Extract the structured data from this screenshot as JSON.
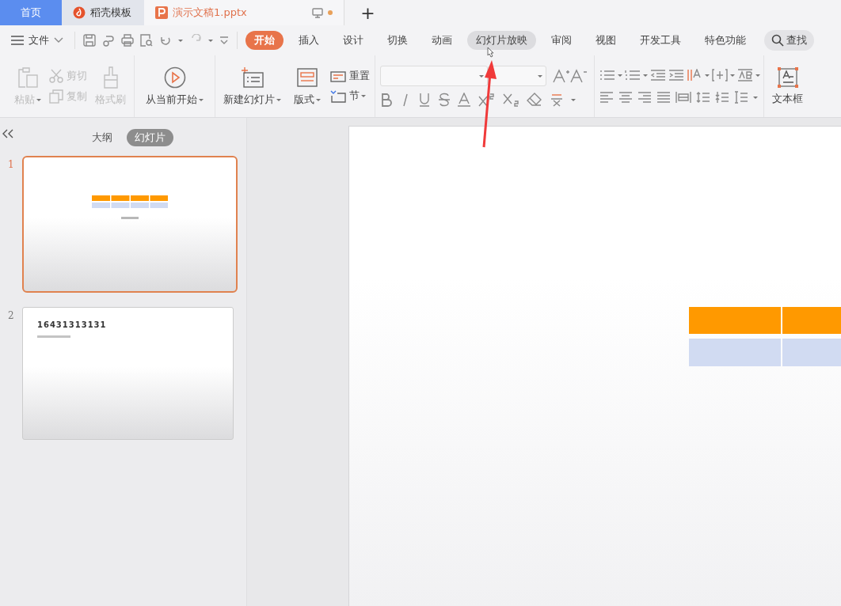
{
  "tabs": [
    {
      "kind": "home",
      "label": "首页",
      "selected": false
    },
    {
      "kind": "template",
      "label": "稻壳模板",
      "selected": false
    },
    {
      "kind": "document",
      "label": "演示文稿1.pptx",
      "selected": true,
      "modified": true
    }
  ],
  "new_tab": "+",
  "menu": {
    "file": "文件",
    "tabs": [
      {
        "label": "开始",
        "selected": true,
        "hovered": false
      },
      {
        "label": "插入",
        "selected": false,
        "hovered": false
      },
      {
        "label": "设计",
        "selected": false,
        "hovered": false
      },
      {
        "label": "切换",
        "selected": false,
        "hovered": false
      },
      {
        "label": "动画",
        "selected": false,
        "hovered": false
      },
      {
        "label": "幻灯片放映",
        "selected": false,
        "hovered": true
      },
      {
        "label": "审阅",
        "selected": false,
        "hovered": false
      },
      {
        "label": "视图",
        "selected": false,
        "hovered": false
      },
      {
        "label": "开发工具",
        "selected": false,
        "hovered": false
      },
      {
        "label": "特色功能",
        "selected": false,
        "hovered": false
      }
    ],
    "search": "查找"
  },
  "ribbon": {
    "paste": {
      "label": "粘贴",
      "disabled": true
    },
    "cut": {
      "label": "剪切",
      "disabled": true
    },
    "copy": {
      "label": "复制",
      "disabled": true
    },
    "format_painter": {
      "label": "格式刷",
      "disabled": true
    },
    "play_from_current": "从当前开始",
    "new_slide": "新建幻灯片",
    "layout": "版式",
    "reset": "重置",
    "section": "节",
    "text_box": "文本框"
  },
  "pane": {
    "views": [
      {
        "label": "大纲",
        "selected": false
      },
      {
        "label": "幻灯片",
        "selected": true
      }
    ],
    "slides": [
      {
        "number": "1",
        "selected": true,
        "kind": "table"
      },
      {
        "number": "2",
        "selected": false,
        "kind": "text",
        "title": "16431313131"
      }
    ]
  }
}
